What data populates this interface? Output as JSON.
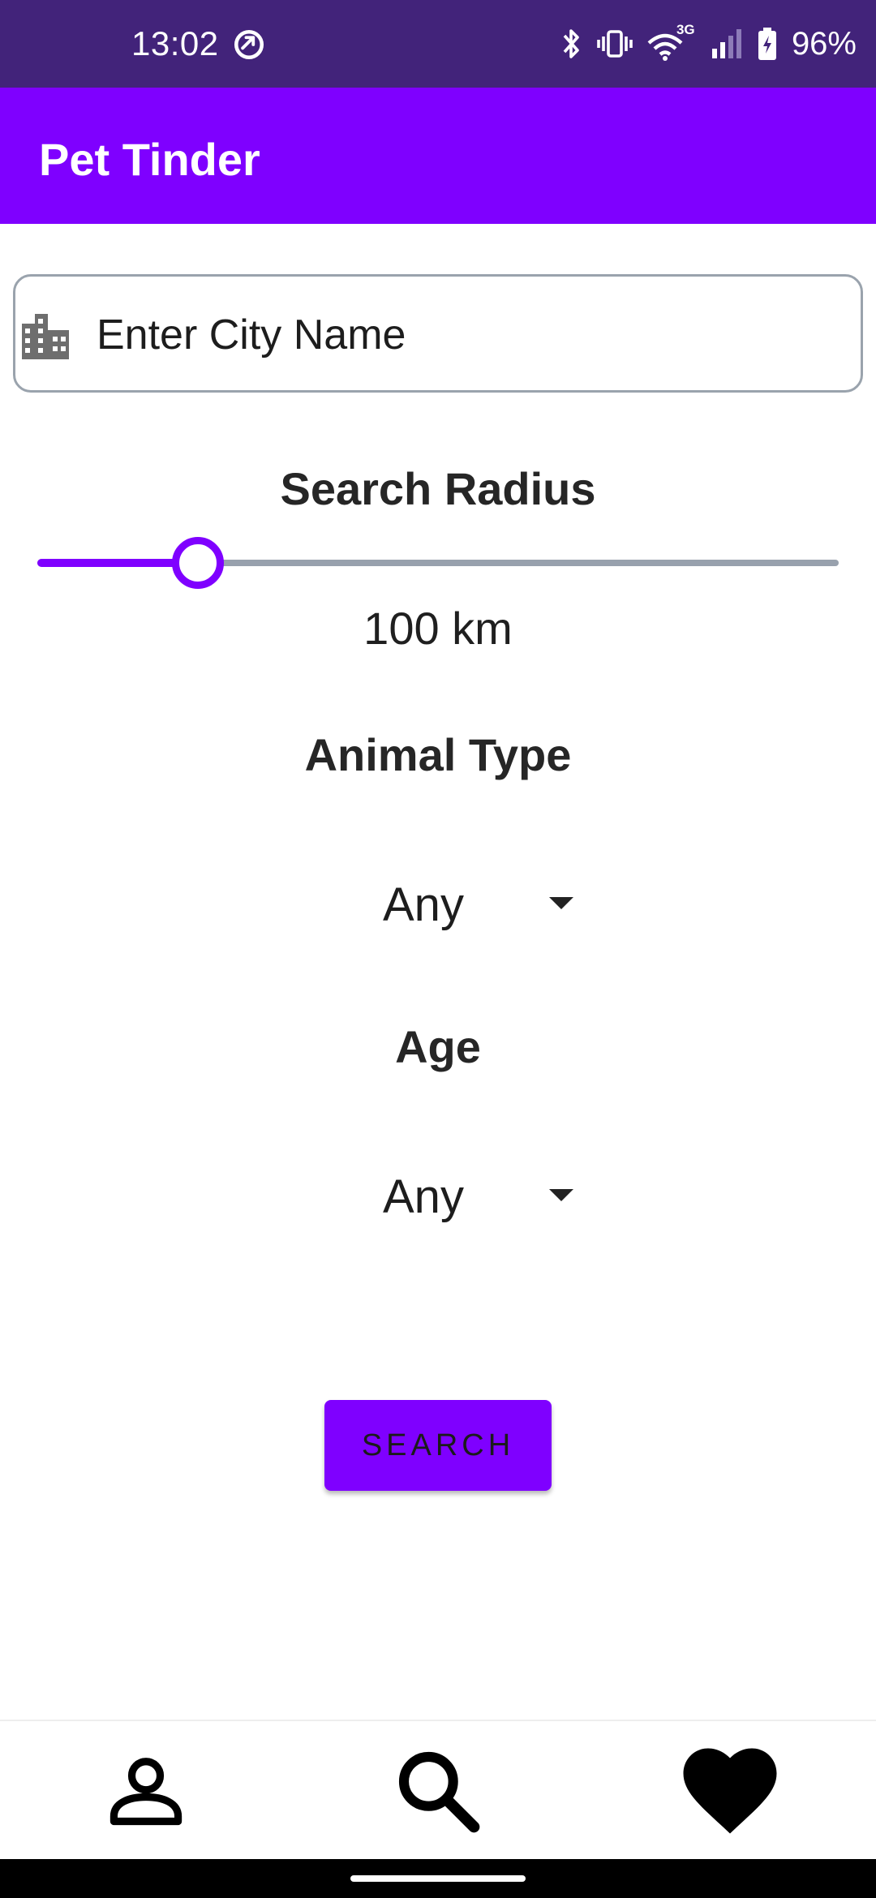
{
  "status_bar": {
    "time": "13:02",
    "battery_text": "96%",
    "network_label": "3G",
    "icons": [
      "sync-icon",
      "bluetooth-icon",
      "vibrate-icon",
      "wifi-icon",
      "cellular-signal-icon",
      "battery-charging-icon"
    ]
  },
  "app_bar": {
    "title": "Pet Tinder",
    "color": "#7f00ff"
  },
  "city": {
    "placeholder": "Enter City Name",
    "value": "",
    "icon": "city-building-icon"
  },
  "radius": {
    "heading": "Search Radius",
    "value_text": "100 km",
    "slider_fraction": 0.2
  },
  "animal_type": {
    "heading": "Animal Type",
    "selected": "Any"
  },
  "age": {
    "heading": "Age",
    "selected": "Any"
  },
  "search_button": {
    "label": "SEARCH"
  },
  "bottom_nav": {
    "items": [
      "profile-icon",
      "search-icon",
      "favorites-heart-icon"
    ]
  },
  "colors": {
    "accent": "#7f00ff",
    "status_bar": "#42237a",
    "track": "#98a1ad"
  }
}
